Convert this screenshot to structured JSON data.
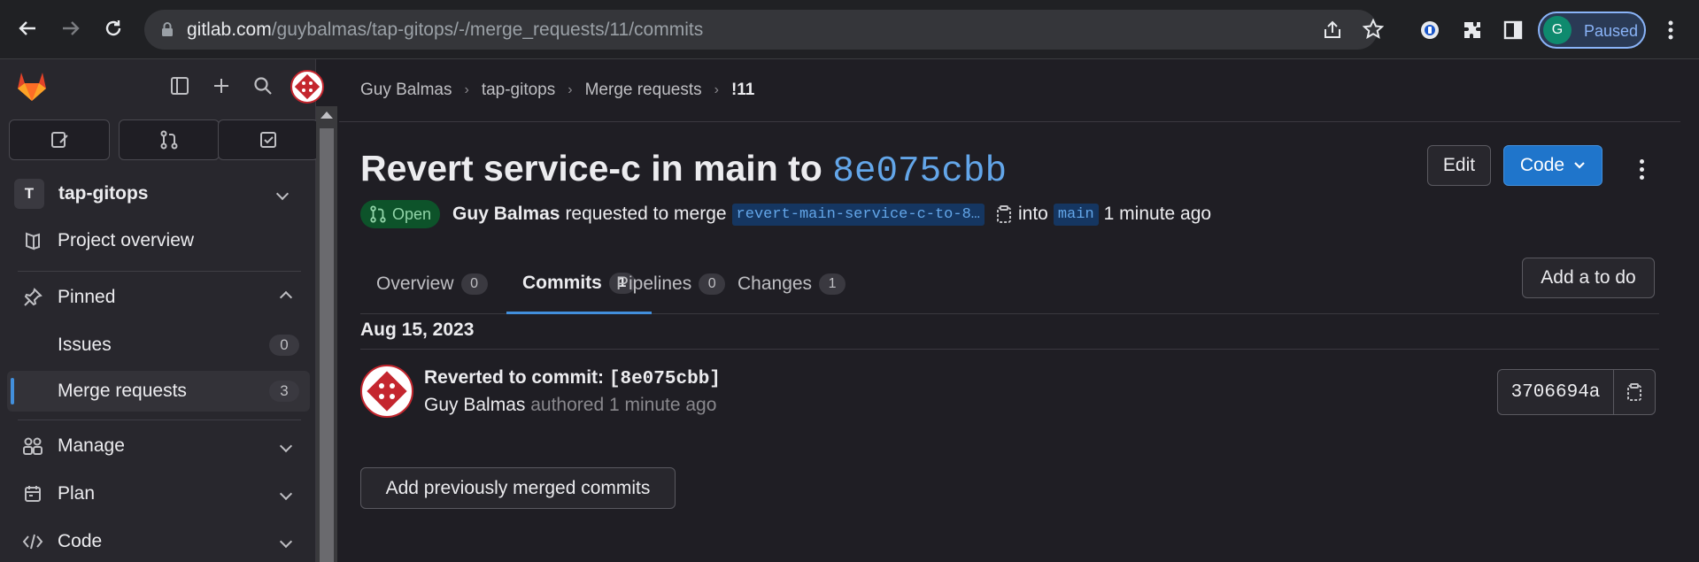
{
  "browser": {
    "url_host": "gitlab.com",
    "url_path": "/guybalmas/tap-gitops/-/merge_requests/11/commits",
    "profile_initial": "G",
    "profile_label": "Paused"
  },
  "sidebar": {
    "project_badge": "T",
    "project_name": "tap-gitops",
    "items": [
      {
        "label": "Project overview"
      },
      {
        "label": "Pinned"
      },
      {
        "label": "Issues",
        "count": "0"
      },
      {
        "label": "Merge requests",
        "count": "3"
      },
      {
        "label": "Manage"
      },
      {
        "label": "Plan"
      },
      {
        "label": "Code"
      }
    ]
  },
  "breadcrumb": [
    "Guy Balmas",
    "tap-gitops",
    "Merge requests",
    "!11"
  ],
  "mr": {
    "title_prefix": "Revert service-c in main to ",
    "title_sha": "8e075cbb",
    "edit_label": "Edit",
    "code_label": "Code",
    "status": "Open",
    "author": "Guy Balmas",
    "requested_text": "requested to merge",
    "source_branch": "revert-main-service-c-to-8…",
    "into_text": "into",
    "target_branch": "main",
    "time_ago": "1 minute ago"
  },
  "tabs": [
    {
      "label": "Overview",
      "count": "0"
    },
    {
      "label": "Commits",
      "count": "1"
    },
    {
      "label": "Pipelines",
      "count": "0"
    },
    {
      "label": "Changes",
      "count": "1"
    }
  ],
  "todo_label": "Add a to do",
  "commits": {
    "date": "Aug 15, 2023",
    "title_prefix": "Reverted to commit: ",
    "title_ref": "[8e075cbb]",
    "author": "Guy Balmas",
    "authored_text": "authored",
    "time_ago": "1 minute ago",
    "short_sha": "3706694a"
  },
  "add_previous_label": "Add previously merged commits",
  "colors": {
    "accent": "#428fdc",
    "primary_button": "#1f75cb",
    "open_badge": "#0d532a",
    "avatar_red": "#c4262e"
  }
}
